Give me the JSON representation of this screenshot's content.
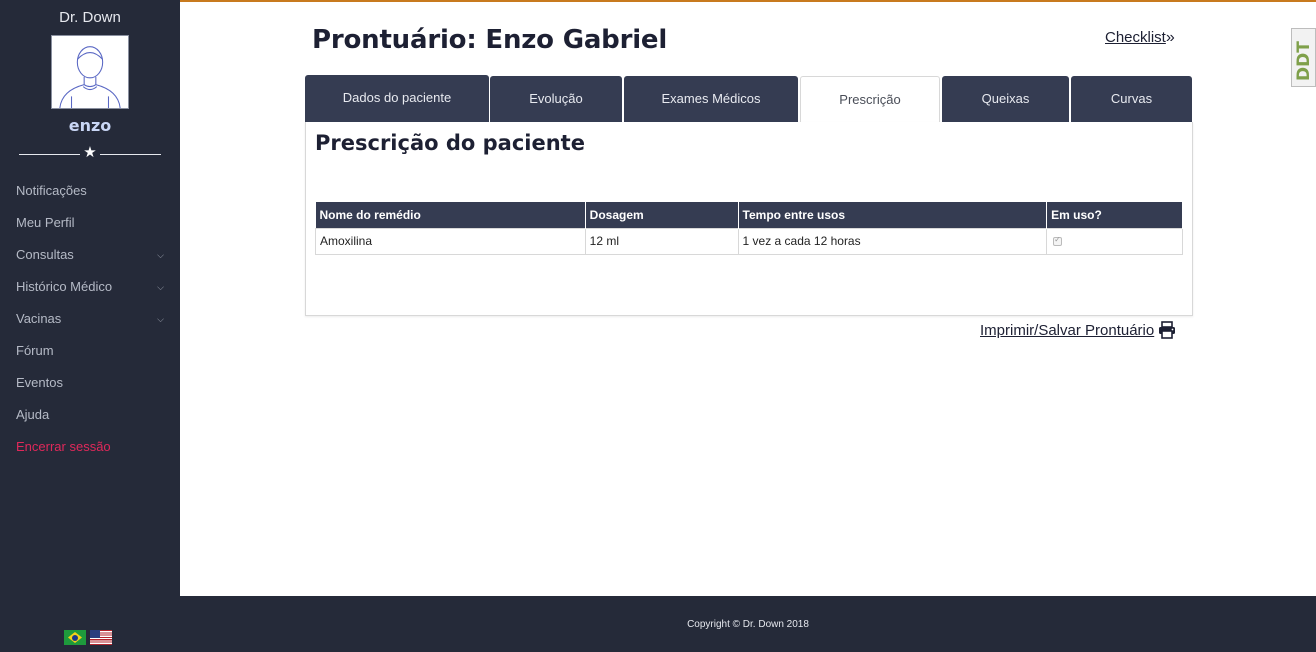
{
  "app": {
    "brand": "Dr. Down",
    "username": "enzo"
  },
  "sidebar": {
    "items": [
      {
        "label": "Notificações",
        "has_chevron": false
      },
      {
        "label": "Meu Perfil",
        "has_chevron": false
      },
      {
        "label": "Consultas",
        "has_chevron": true
      },
      {
        "label": "Histórico Médico",
        "has_chevron": true
      },
      {
        "label": "Vacinas",
        "has_chevron": true
      },
      {
        "label": "Fórum",
        "has_chevron": false
      },
      {
        "label": "Eventos",
        "has_chevron": false
      },
      {
        "label": "Ajuda",
        "has_chevron": false
      },
      {
        "label": "Encerrar sessão",
        "has_chevron": false
      }
    ],
    "flags": [
      "brazil-flag",
      "us-flag"
    ]
  },
  "header": {
    "title": "Prontuário: Enzo Gabriel",
    "checklist_label": "Checklist",
    "badge_text": "DDT"
  },
  "tabs": [
    {
      "label": "Dados do paciente",
      "active": false
    },
    {
      "label": "Evolução",
      "active": false
    },
    {
      "label": "Exames Médicos",
      "active": false
    },
    {
      "label": "Prescrição",
      "active": true
    },
    {
      "label": "Queixas",
      "active": false
    },
    {
      "label": "Curvas",
      "active": false
    }
  ],
  "panel": {
    "title": "Prescrição do paciente",
    "table": {
      "headers": [
        "Nome do remédio",
        "Dosagem",
        "Tempo entre usos",
        "Em uso?"
      ],
      "rows": [
        {
          "nome": "Amoxilina",
          "dosagem": "12 ml",
          "tempo": "1 vez a cada 12 horas",
          "em_uso": true
        }
      ]
    }
  },
  "print_label": "Imprimir/Salvar Prontuário",
  "footer": {
    "copyright": "Copyright © Dr. Down 2018"
  },
  "colors": {
    "sidebar_bg": "#252a39",
    "tab_bg": "#353c52",
    "logout": "#e0285a",
    "accent_line": "#c87a1e"
  }
}
